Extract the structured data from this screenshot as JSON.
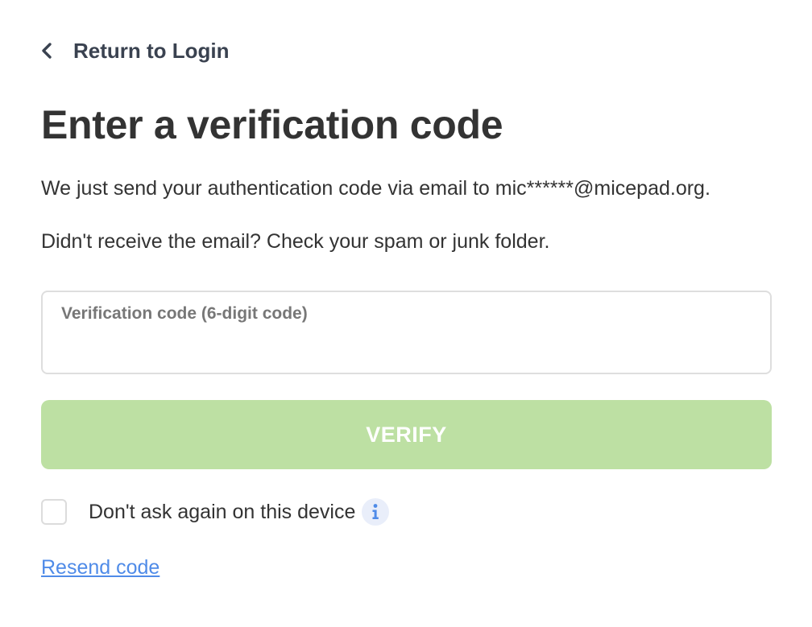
{
  "nav": {
    "back_label": "Return to Login",
    "back_icon": "chevron-left-icon"
  },
  "header": {
    "title": "Enter a verification code"
  },
  "messages": {
    "sent_notice": "We just send your authentication code via email to mic******@micepad.org.",
    "spam_hint": "Didn't receive the email? Check your spam or junk folder."
  },
  "form": {
    "code_field": {
      "label": "Verification code (6-digit code)",
      "value": ""
    },
    "verify_label": "VERIFY",
    "remember_label": "Don't ask again on this device",
    "remember_checked": false,
    "info_icon": "info-icon",
    "resend_label": "Resend code"
  },
  "colors": {
    "text": "#333333",
    "button_disabled_bg": "#bde0a3",
    "link": "#4f8be8",
    "info_badge_bg": "#e9eefa",
    "info_glyph": "#4f8be8"
  }
}
